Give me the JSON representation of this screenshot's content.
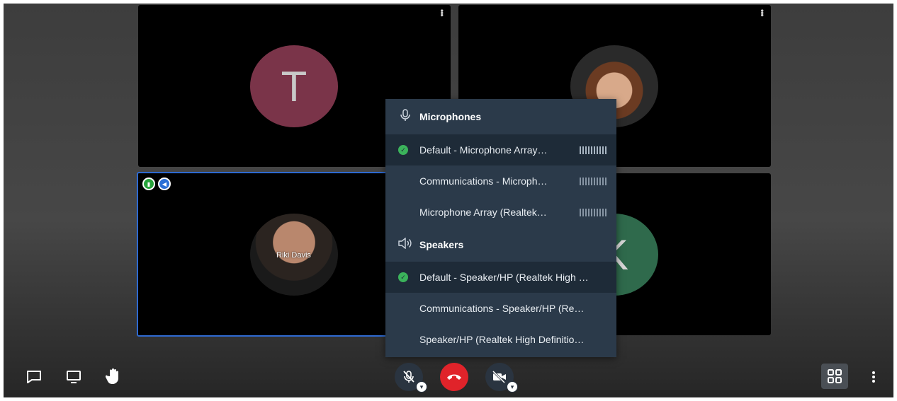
{
  "participants": {
    "tile_t_initial": "T",
    "tile_k_initial": "K",
    "riki_name": "Riki Davis"
  },
  "device_menu": {
    "microphones_heading": "Microphones",
    "microphones": [
      {
        "label": "Default - Microphone Array…",
        "selected": true
      },
      {
        "label": "Communications - Microph…",
        "selected": false
      },
      {
        "label": "Microphone Array (Realtek…",
        "selected": false
      }
    ],
    "speakers_heading": "Speakers",
    "speakers": [
      {
        "label": "Default - Speaker/HP (Realtek High …",
        "selected": true
      },
      {
        "label": "Communications - Speaker/HP (Re…",
        "selected": false
      },
      {
        "label": "Speaker/HP (Realtek High Definitio…",
        "selected": false
      }
    ]
  },
  "icons": {
    "chat": "chat-icon",
    "share_screen": "screen-share-icon",
    "raise_hand": "hand-icon",
    "mic_muted": "mic-muted-icon",
    "hang_up": "phone-hangup-icon",
    "video_off": "video-off-icon",
    "layout": "grid-layout-icon",
    "more": "more-vertical-icon"
  },
  "colors": {
    "hangup_red": "#e0232a",
    "selected_green": "#3bb35b",
    "active_speaker_blue": "#2e6ad1",
    "popup_bg": "#2b3a4a"
  }
}
